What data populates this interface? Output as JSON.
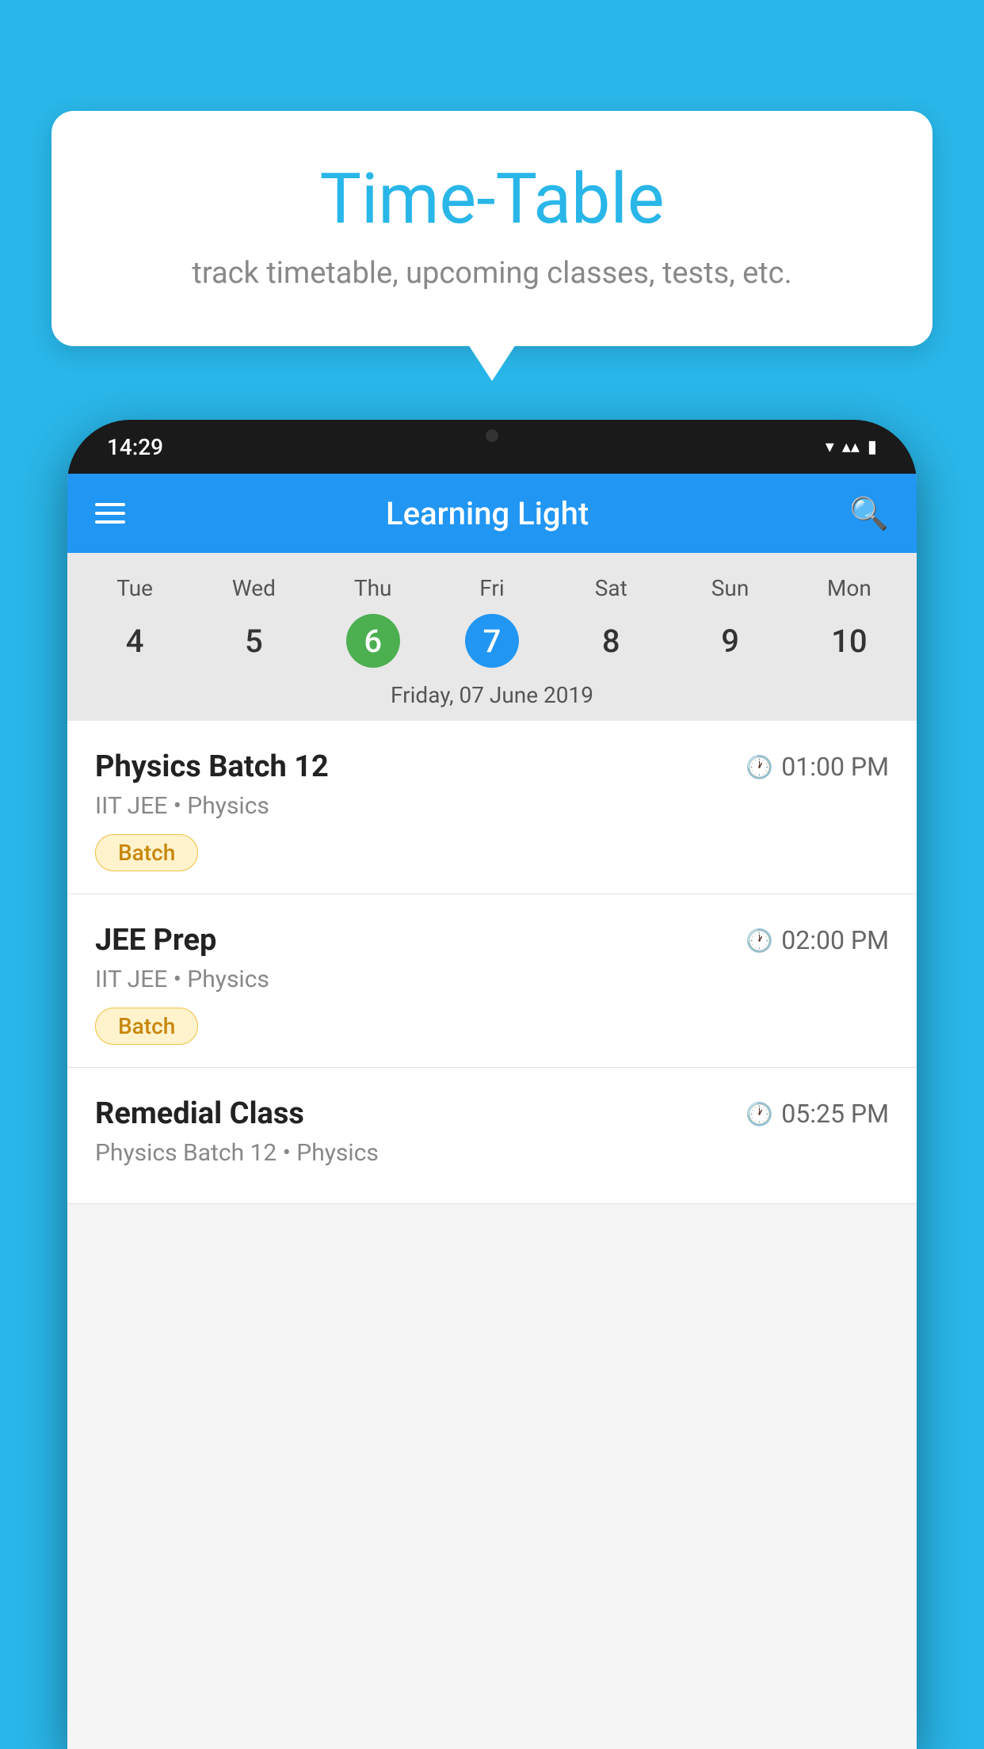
{
  "bubble": {
    "title": "Time-Table",
    "subtitle": "track timetable, upcoming classes, tests, etc."
  },
  "phone": {
    "status_time": "14:29",
    "app_title": "Learning Light"
  },
  "calendar": {
    "days": [
      {
        "label": "Tue",
        "num": "4"
      },
      {
        "label": "Wed",
        "num": "5"
      },
      {
        "label": "Thu",
        "num": "6",
        "state": "today"
      },
      {
        "label": "Fri",
        "num": "7",
        "state": "selected"
      },
      {
        "label": "Sat",
        "num": "8"
      },
      {
        "label": "Sun",
        "num": "9"
      },
      {
        "label": "Mon",
        "num": "10"
      }
    ],
    "selected_date_label": "Friday, 07 June 2019"
  },
  "classes": [
    {
      "name": "Physics Batch 12",
      "time": "01:00 PM",
      "meta": "IIT JEE • Physics",
      "badge": "Batch"
    },
    {
      "name": "JEE Prep",
      "time": "02:00 PM",
      "meta": "IIT JEE • Physics",
      "badge": "Batch"
    },
    {
      "name": "Remedial Class",
      "time": "05:25 PM",
      "meta": "Physics Batch 12 • Physics",
      "badge": null
    }
  ],
  "labels": {
    "hamburger": "☰",
    "search": "🔍",
    "clock": "🕐"
  }
}
